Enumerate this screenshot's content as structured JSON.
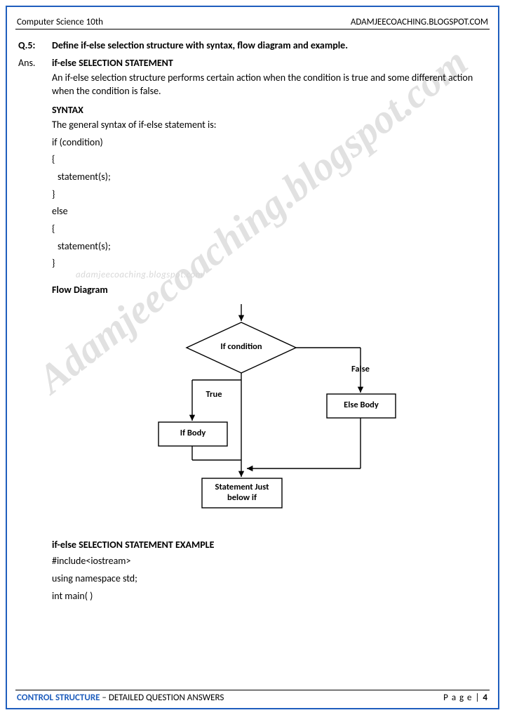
{
  "header": {
    "left": "Computer Science 10th",
    "right": "ADAMJEECOACHING.BLOGSPOT.COM"
  },
  "footer": {
    "topic_highlight": "CONTROL STRUCTURE",
    "topic_rest": " – DETAILED QUESTION ANSWERS",
    "page_label": "P a g e",
    "page_sep": " | ",
    "page_num": "4"
  },
  "watermarks": {
    "small": "adamjeecoaching.blogspot.com",
    "big": "Adamjeecoaching.blogspot.com"
  },
  "question": {
    "number": "Q.5:",
    "text": "Define if-else selection structure with syntax, flow diagram and example."
  },
  "answer": {
    "label": "Ans.",
    "title": "if-else SELECTION STATEMENT",
    "intro": "An if-else selection structure performs certain action when the condition is true and some different action when the condition is false.",
    "syntax_heading": "SYNTAX",
    "syntax_lead": "The general syntax of if-else statement is:",
    "syntax_lines": [
      "if (condition)",
      "{",
      " statement(s);",
      "}",
      "else",
      "{",
      " statement(s);",
      "}"
    ],
    "flow_heading": "Flow Diagram",
    "example_heading": "if-else SELECTION STATEMENT EXAMPLE",
    "example_lines": [
      "#include<iostream>",
      "using namespace std;",
      "int main( )"
    ]
  },
  "flow": {
    "condition": "If condition",
    "true_label": "True",
    "false_label": "False",
    "if_body": "If Body",
    "else_body": "Else Body",
    "after": "Statement Just below if"
  }
}
